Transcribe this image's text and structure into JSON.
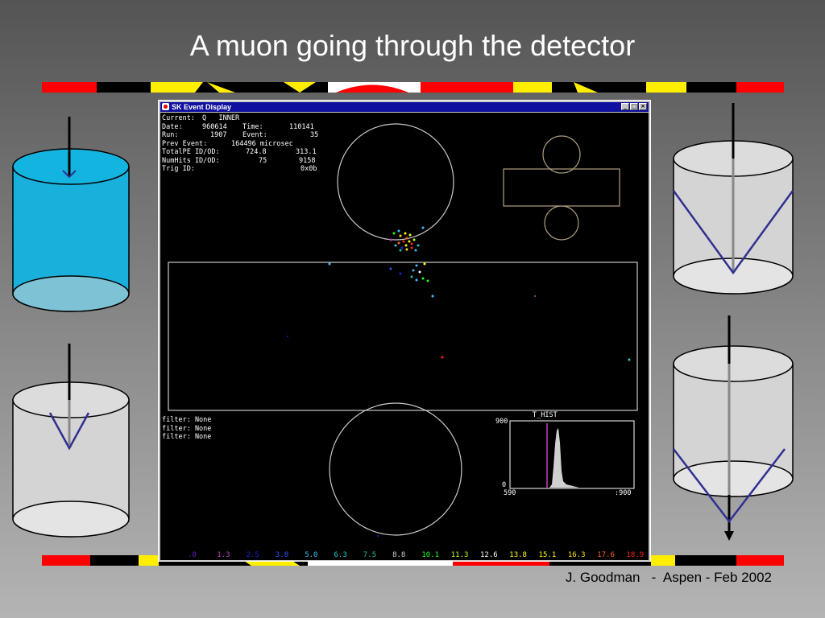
{
  "slide": {
    "title": "A muon going through the detector",
    "footer": "J. Goodman   -  Aspen - Feb 2002"
  },
  "colors": {
    "stripe_red": "#ff0000",
    "stripe_yellow": "#ffee00",
    "stripe_black": "#000000",
    "stripe_white": "#ffffff",
    "tank_blue": "#1ab0dc",
    "tank_gray": "#d4d4d4",
    "cherenkov_cone": "#303090",
    "display_background": "#000000",
    "window_titlebar": "#1010a0"
  },
  "window": {
    "title": "SK Event Display",
    "buttons": {
      "minimize": "_",
      "maximize": "□",
      "close": "×"
    }
  },
  "event_info": {
    "current_label": "Current:",
    "current_value": "Q   INNER",
    "date_label": "Date:",
    "date_value": "960614",
    "time_label": "Time:",
    "time_value": "110141",
    "run_label": "Run:",
    "run_value": "1907",
    "event_label": "Event:",
    "event_value": "35",
    "prev_event_label": "Prev Event:",
    "prev_event_value": "164496 microsec",
    "total_pe_label": "TotalPE ID/OD:",
    "total_pe_id": "724.8",
    "total_pe_od": "313.1",
    "num_hits_label": "NumHits ID/OD:",
    "num_hits_id": "75",
    "num_hits_od": "9158",
    "trig_id_label": "Trig ID:",
    "trig_id_value": "0x0b"
  },
  "filters": [
    "filter: None",
    "filter: None",
    "filter: None"
  ],
  "histogram": {
    "title": "T_HIST",
    "y_max_label": "900",
    "y_min_label": "0",
    "x_min_label": "590",
    "x_max_label": ":900"
  },
  "color_scale": [
    {
      "label": ".0",
      "color": "#6020c0"
    },
    {
      "label": "1.3",
      "color": "#c040c0"
    },
    {
      "label": "2.5",
      "color": "#2020d0"
    },
    {
      "label": "3.8",
      "color": "#3050ff"
    },
    {
      "label": "5.0",
      "color": "#40c0ff"
    },
    {
      "label": "6.3",
      "color": "#20d0d0"
    },
    {
      "label": "7.5",
      "color": "#20c0a0"
    },
    {
      "label": "8.8",
      "color": "#d0d0d0"
    },
    {
      "label": "10.1",
      "color": "#20ff20"
    },
    {
      "label": "11.3",
      "color": "#c0ff20"
    },
    {
      "label": "12.6",
      "color": "#ffffff"
    },
    {
      "label": "13.8",
      "color": "#ffff20"
    },
    {
      "label": "15.1",
      "color": "#ffff00"
    },
    {
      "label": "16.3",
      "color": "#ffe020"
    },
    {
      "label": "17.6",
      "color": "#ff6020"
    },
    {
      "label": "18.9",
      "color": "#ff2020"
    }
  ]
}
